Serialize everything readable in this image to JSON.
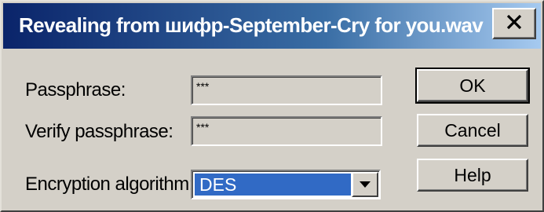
{
  "dialog": {
    "title": "Revealing from шифр-September-Cry for you.wav",
    "close_icon": "close-x-icon"
  },
  "form": {
    "passphrase_label": "Passphrase:",
    "passphrase_value": "***",
    "verify_label": "Verify passphrase:",
    "verify_value": "***",
    "algorithm_label": "Encryption algorithm:",
    "algorithm_selected": "DES",
    "dropdown_icon": "chevron-down-icon"
  },
  "buttons": {
    "ok": "OK",
    "cancel": "Cancel",
    "help": "Help"
  },
  "colors": {
    "titlebar_start": "#0a246a",
    "titlebar_end": "#a6caf0",
    "selection": "#316ac5",
    "face": "#d4d0c8"
  }
}
